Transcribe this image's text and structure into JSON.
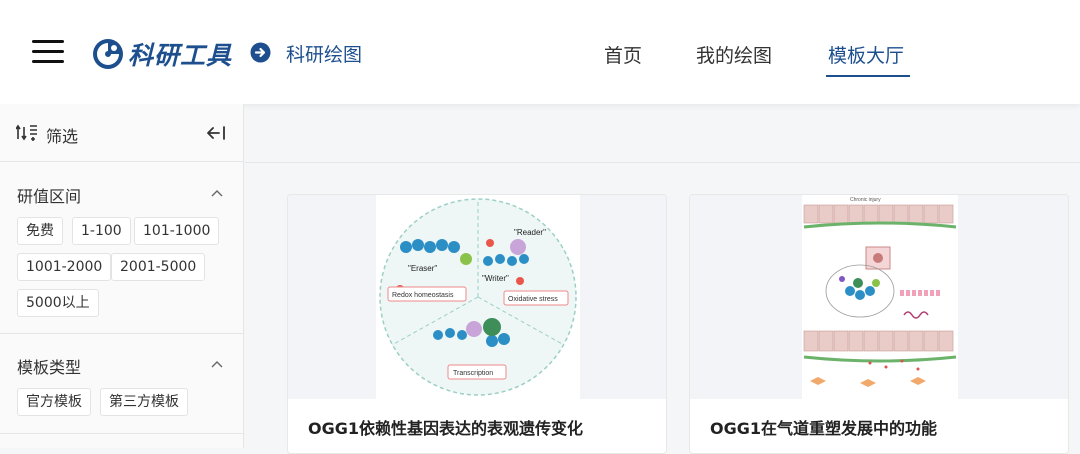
{
  "header": {
    "brand": "科研工具",
    "sub_title": "科研绘图",
    "nav": [
      {
        "label": "首页",
        "active": false
      },
      {
        "label": "我的绘图",
        "active": false
      },
      {
        "label": "模板大厅",
        "active": true
      }
    ],
    "accent_color": "#1d4f8f"
  },
  "sidebar": {
    "filter_label": "筛选",
    "sections": [
      {
        "title": "研值区间",
        "tags": [
          "免费",
          "1-100",
          "101-1000",
          "1001-2000",
          "2001-5000",
          "5000以上"
        ]
      },
      {
        "title": "模板类型",
        "tags": [
          "官方模板",
          "第三方模板"
        ]
      }
    ]
  },
  "cards": [
    {
      "title": "OGG1依赖性基因表达的表观遗传变化",
      "figure_labels": [
        "\"Eraser\"",
        "\"Reader\"",
        "\"Writer\"",
        "Redox homeostasis",
        "Oxidative stress",
        "Transcription"
      ]
    },
    {
      "title": "OGG1在气道重塑发展中的功能",
      "figure_labels": [
        "Chronic injury"
      ]
    }
  ],
  "icons": {
    "menu": "hamburger-icon",
    "logo": "logo-icon",
    "arrow": "arrow-right-circle-icon",
    "filter": "sort-filter-icon",
    "collapse": "collapse-left-icon",
    "caret": "chevron-up-icon"
  }
}
